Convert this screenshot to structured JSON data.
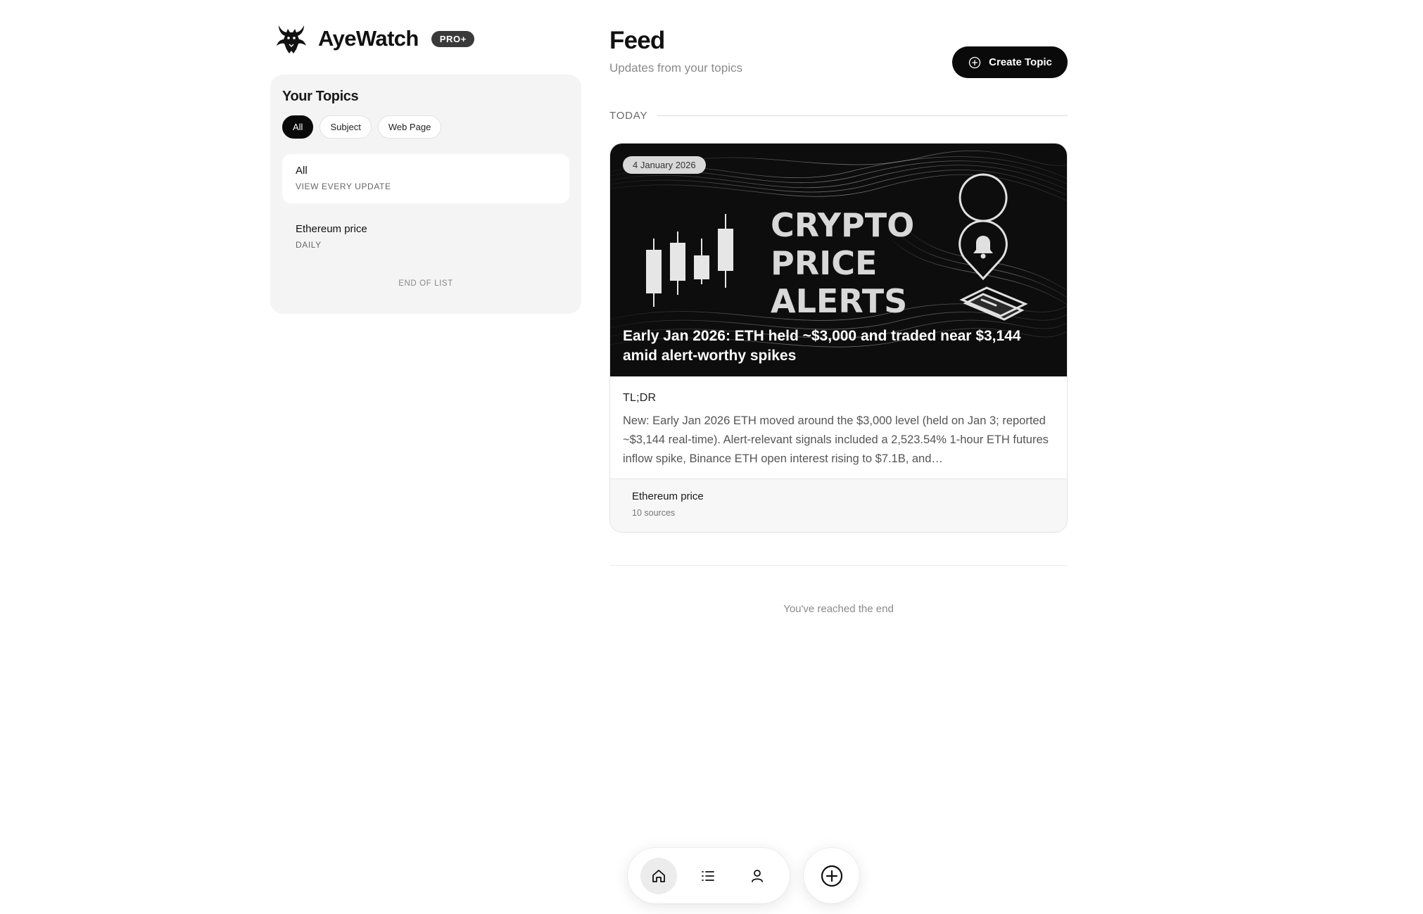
{
  "app": {
    "name": "AyeWatch",
    "plan_badge": "PRO+"
  },
  "sidebar": {
    "title": "Your Topics",
    "filters": [
      {
        "label": "All",
        "active": true
      },
      {
        "label": "Subject",
        "active": false
      },
      {
        "label": "Web Page",
        "active": false
      }
    ],
    "topics": [
      {
        "name": "All",
        "subtitle": "VIEW EVERY UPDATE",
        "selected": true
      },
      {
        "name": "Ethereum price",
        "subtitle": "DAILY",
        "selected": false
      }
    ],
    "end_label": "END OF LIST"
  },
  "feed": {
    "title": "Feed",
    "subtitle": "Updates from your topics",
    "create_button": "Create Topic",
    "section_label": "TODAY",
    "cards": [
      {
        "date": "4 January 2026",
        "image_text": [
          "CRYPTO",
          "PRICE",
          "ALERTS"
        ],
        "headline": "Early Jan 2026: ETH held ~$3,000 and traded near $3,144 amid alert-worthy spikes",
        "tldr_label": "TL;DR",
        "tldr": "New: Early Jan 2026 ETH moved around the $3,000 level (held on Jan 3; reported ~$3,144 real-time). Alert-relevant signals included a 2,523.54% 1-hour ETH futures inflow spike, Binance ETH open interest rising to $7.1B, and…",
        "topic": "Ethereum price",
        "sources": "10 sources"
      }
    ],
    "end_note": "You've reached the end"
  },
  "bottom_nav": {
    "items": [
      {
        "icon": "home-icon",
        "active": true
      },
      {
        "icon": "list-icon",
        "active": false
      },
      {
        "icon": "profile-icon",
        "active": false
      }
    ],
    "fab_icon": "plus-circle-icon"
  },
  "colors": {
    "primary": "#0a0a0a",
    "panel": "#f4f4f4",
    "muted": "#8a8a8a"
  }
}
